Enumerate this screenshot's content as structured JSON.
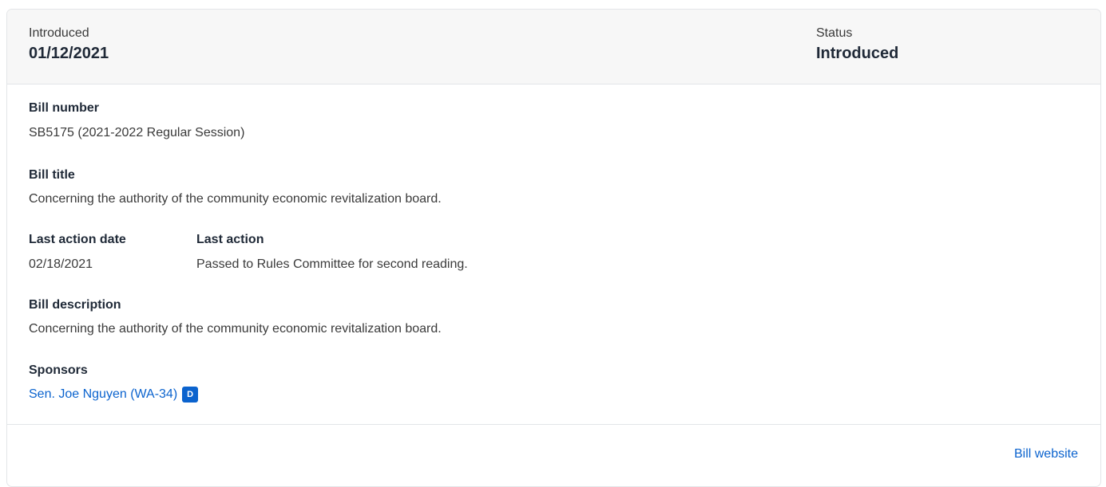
{
  "header": {
    "introduced_label": "Introduced",
    "introduced_date": "01/12/2021",
    "status_label": "Status",
    "status_value": "Introduced"
  },
  "bill": {
    "number_label": "Bill number",
    "number_value": "SB5175 (2021-2022 Regular Session)",
    "title_label": "Bill title",
    "title_value": "Concerning the authority of the community economic revitalization board.",
    "last_action_date_label": "Last action date",
    "last_action_date_value": "02/18/2021",
    "last_action_label": "Last action",
    "last_action_value": "Passed to Rules Committee for second reading.",
    "description_label": "Bill description",
    "description_value": "Concerning the authority of the community economic revitalization board."
  },
  "sponsors": {
    "label": "Sponsors",
    "items": [
      {
        "name": "Sen. Joe Nguyen (WA-34)",
        "party": "D"
      }
    ]
  },
  "footer": {
    "website_link": "Bill website"
  },
  "colors": {
    "link": "#0b63ce",
    "header_bg": "#f7f7f7",
    "border": "#e3e5e8"
  }
}
